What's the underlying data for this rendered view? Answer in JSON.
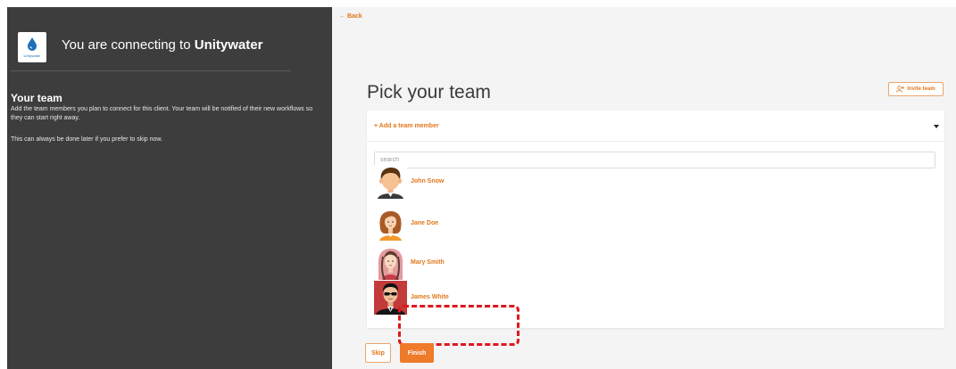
{
  "brand": {
    "logo_text": "Unitywater",
    "connect_prefix": "You are connecting to",
    "client_name": "Unitywater"
  },
  "left_panel": {
    "title": "Your team",
    "description": "Add the team members you plan to connect for this client. Your team will be notified of their new workflows so they can start right away.",
    "note": "This can always be done later if you prefer to skip now."
  },
  "nav": {
    "back_label": "Back"
  },
  "main": {
    "title": "Pick your team",
    "invite_label": "Invite team",
    "add_member_label": "Add a team member",
    "search_placeholder": "search",
    "members": [
      {
        "name": "John Snow",
        "avatar": "avatar-man-icon"
      },
      {
        "name": "Jane Doe",
        "avatar": "avatar-woman-icon"
      },
      {
        "name": "Mary Smith",
        "avatar": "avatar-woman-icon"
      },
      {
        "name": "James White",
        "avatar": "avatar-man-sunglasses-icon"
      }
    ]
  },
  "actions": {
    "skip_label": "Skip",
    "finish_label": "Finish"
  },
  "colors": {
    "accent": "#e2771b",
    "panel": "#3d3d3d",
    "highlight": "#e0161e"
  }
}
